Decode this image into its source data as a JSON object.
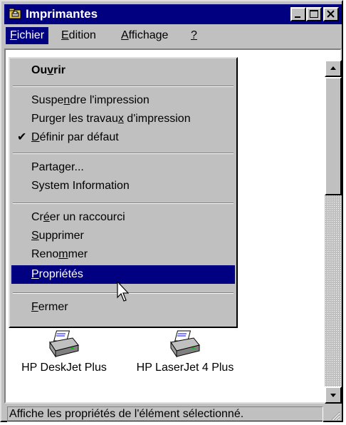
{
  "window": {
    "title": "Imprimantes",
    "title_icon": "printer-folder-icon"
  },
  "menubar": {
    "items": [
      {
        "pre": "",
        "ul": "F",
        "post": "ichier"
      },
      {
        "pre": "",
        "ul": "E",
        "post": "dition"
      },
      {
        "pre": "",
        "ul": "A",
        "post": "ffichage"
      },
      {
        "pre": "",
        "ul": "?",
        "post": ""
      }
    ]
  },
  "dropdown": {
    "items": [
      {
        "pre": "Ou",
        "ul": "v",
        "post": "rir"
      },
      {
        "pre": "Suspe",
        "ul": "n",
        "post": "dre l'impression"
      },
      {
        "pre": "Purger les travau",
        "ul": "x",
        "post": " d'impression"
      },
      {
        "pre": "",
        "ul": "D",
        "post": "éfinir par défaut"
      },
      {
        "pre": "Parta",
        "ul": "g",
        "post": "er..."
      },
      {
        "pre": "System Information",
        "ul": "",
        "post": ""
      },
      {
        "pre": "Cr",
        "ul": "é",
        "post": "er un raccourci"
      },
      {
        "pre": "",
        "ul": "S",
        "post": "upprimer"
      },
      {
        "pre": "Reno",
        "ul": "m",
        "post": "mer"
      },
      {
        "pre": "",
        "ul": "P",
        "post": "ropriétés"
      },
      {
        "pre": "",
        "ul": "F",
        "post": "ermer"
      }
    ],
    "check_mark": "✔"
  },
  "printers": [
    {
      "label": "HP DeskJet Plus"
    },
    {
      "label": "HP LaserJet 4 Plus"
    }
  ],
  "statusbar": {
    "text": "Affiche les propriétés de l'élément sélectionné."
  }
}
